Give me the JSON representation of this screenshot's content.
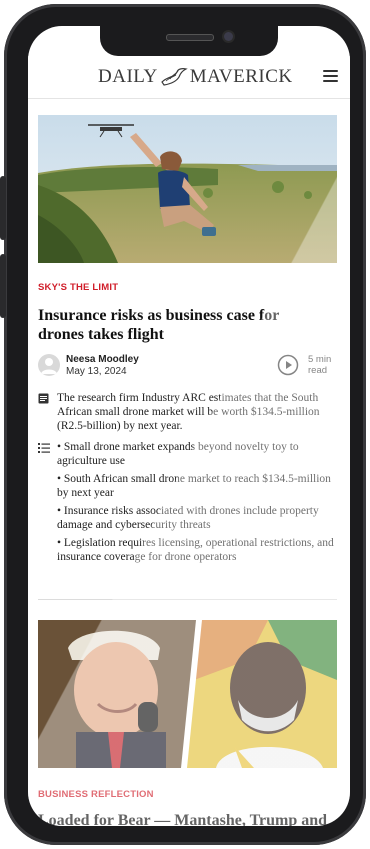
{
  "header": {
    "logo_left": "DAILY",
    "logo_right": "MAVERICK",
    "menu_icon": "hamburger-menu-icon"
  },
  "article1": {
    "category": "SKY'S THE LIMIT",
    "headline": "Insurance risks as business case for drones takes flight",
    "author": "Neesa Moodley",
    "date": "May 13, 2024",
    "read_time": "5 min read",
    "summary": "The research firm Industry ARC estimates that the South African small drone market will be worth $134.5-million (R2.5-billion) by next year.",
    "bullets": [
      "Small drone market expands beyond novelty toy to agriculture use",
      "South African small drone market to reach $134.5-million by next year",
      "Insurance risks associated with drones include property damage and cybersecurity threats",
      "Legislation requires licensing, operational restrictions, and insurance coverage for drone operators"
    ]
  },
  "article2": {
    "category": "BUSINESS REFLECTION",
    "headline": "Loaded for Bear — Mantashe, Trump and"
  },
  "colors": {
    "accent": "#d01e2a",
    "text": "#111111",
    "frame": "#1b1b1d"
  }
}
